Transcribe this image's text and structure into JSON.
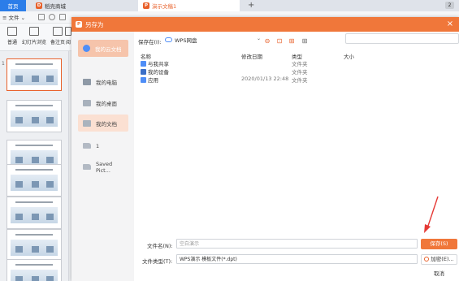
{
  "titlebar": {
    "home_tab": "首页",
    "store_tab": "稻壳商城",
    "doc_tab": "演示文稿1",
    "new_tab": "+",
    "badge": "2"
  },
  "menu": {
    "file_label": "文件"
  },
  "ribbon": {
    "buttons": [
      "普通",
      "幻灯片浏览",
      "备注页",
      "阅"
    ]
  },
  "slides": {
    "numbers": [
      "1"
    ]
  },
  "dialog": {
    "title": "另存为",
    "close": "×",
    "sidebar": {
      "items": [
        {
          "label": "我的云文档",
          "icon": "cloud-icon"
        },
        {
          "label": "我的电脑",
          "icon": "computer-icon"
        },
        {
          "label": "我的桌面",
          "icon": "desktop-icon"
        },
        {
          "label": "我的文档",
          "icon": "documents-icon"
        },
        {
          "label": "1",
          "icon": "folder-icon"
        },
        {
          "label": "Saved Pict...",
          "icon": "folder-icon"
        }
      ]
    },
    "location": {
      "label": "保存在(I):",
      "value": "WPS网盘"
    },
    "columns": {
      "name": "名称",
      "date": "修改日期",
      "type": "类型",
      "size": "大小"
    },
    "files": [
      {
        "name": "与我共享",
        "date": "",
        "type": "文件夹",
        "icon": "share-icon",
        "color": "#4f8ef7"
      },
      {
        "name": "我的设备",
        "date": "",
        "type": "文件夹",
        "icon": "device-icon",
        "color": "#3b6fc7"
      },
      {
        "name": "应用",
        "date": "2020/01/13 22:48",
        "type": "文件夹",
        "icon": "app-icon",
        "color": "#4f8ef7"
      }
    ],
    "filename": {
      "label": "文件名(N):",
      "placeholder": "空白演示"
    },
    "filetype": {
      "label": "文件类型(T):",
      "value": "WPS演示 模板文件(*.dpt)"
    },
    "buttons": {
      "save": "保存(S)",
      "encrypt": "加密(E)...",
      "cancel": "取消"
    },
    "accent_color": "#f0773a"
  }
}
